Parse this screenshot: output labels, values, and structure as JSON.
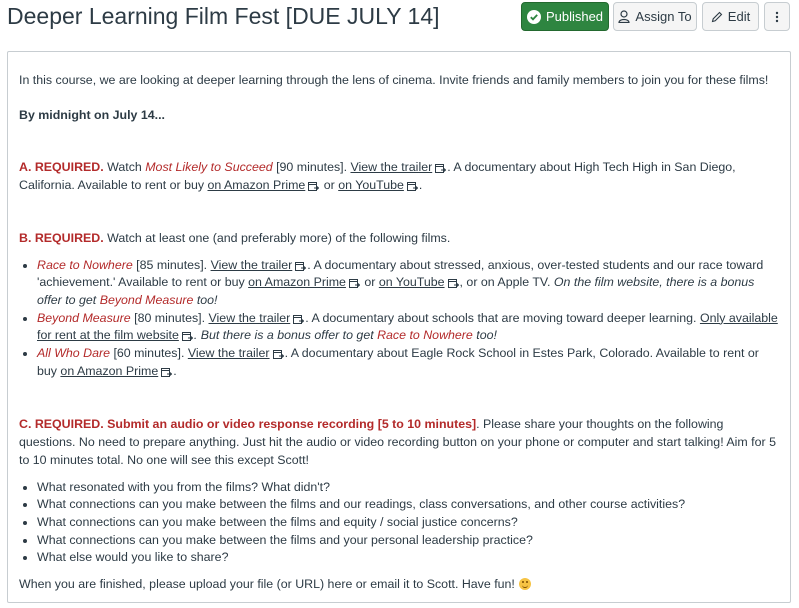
{
  "header": {
    "title": "Deeper Learning Film Fest [DUE JULY 14]",
    "published_label": "Published",
    "assign_label": "Assign To",
    "edit_label": "Edit"
  },
  "content": {
    "intro": "In this course, we are looking at deeper learning through the lens of cinema. Invite friends and family members to join you for these films!",
    "deadline": "By midnight on July 14...",
    "a": {
      "req": "A. REQUIRED.",
      "watch": " Watch ",
      "film": "Most Likely to Succeed",
      "mins": " [90 minutes]. ",
      "trailer": "View the trailer",
      "desc": ". A documentary about High Tech High in San Diego, California. Available to rent or buy ",
      "amazon": "on Amazon Prime",
      "or": " or ",
      "youtube": "on YouTube",
      "end": "."
    },
    "b": {
      "req": "B. REQUIRED.",
      "text": " Watch at least one (and preferably more) of the following films.",
      "films": [
        {
          "title": "Race to Nowhere",
          "mins": " [85 minutes]. ",
          "trailer": "View the trailer",
          "desc": ". A documentary about stressed, anxious, over-tested students and our race toward 'achievement.' Available to rent or buy ",
          "amazon": "on Amazon Prime",
          "or": " or ",
          "youtube": "on YouTube",
          "apple": ", or on Apple TV. ",
          "bonus1": "On the film website, there is a bonus offer to get ",
          "bonus_film": "Beyond Measure",
          "bonus2": " too!"
        },
        {
          "title": "Beyond Measure",
          "mins": " [80 minutes]. ",
          "trailer": "View the trailer",
          "desc": ". A documentary about schools that are moving toward deeper learning. ",
          "site": "Only available for rent at the film website",
          "bonus1": ". But there is a bonus offer to get ",
          "bonus_film": "Race to Nowhere",
          "bonus2": " too!"
        },
        {
          "title": "All Who Dare",
          "mins": " [60 minutes]. ",
          "trailer": "View the trailer",
          "desc": ". A documentary about Eagle Rock School in Estes Park, Colorado. Available to rent or buy ",
          "amazon": "on Amazon Prime",
          "end": "."
        }
      ]
    },
    "c": {
      "req": "C. REQUIRED. Submit an audio or video response recording [5 to 10 minutes]",
      "text": ". Please share your thoughts on the following questions. No need to prepare anything. Just hit the audio or video recording button on your phone or computer and start talking! Aim for 5 to 10 minutes total. No one will see this except Scott!",
      "questions": [
        "What resonated with you from the films? What didn't?",
        "What connections can you make between the films and our readings, class conversations, and other course activities?",
        "What connections can you make between the films and equity / social justice concerns?",
        "What connections can you make between the films and your personal leadership practice?",
        "What else would you like to share?"
      ]
    },
    "closing": "When you are finished, please upload your file (or URL) here or email it to Scott. Have fun!"
  },
  "colors": {
    "required": "#b32a2a",
    "published": "#2e8540"
  }
}
